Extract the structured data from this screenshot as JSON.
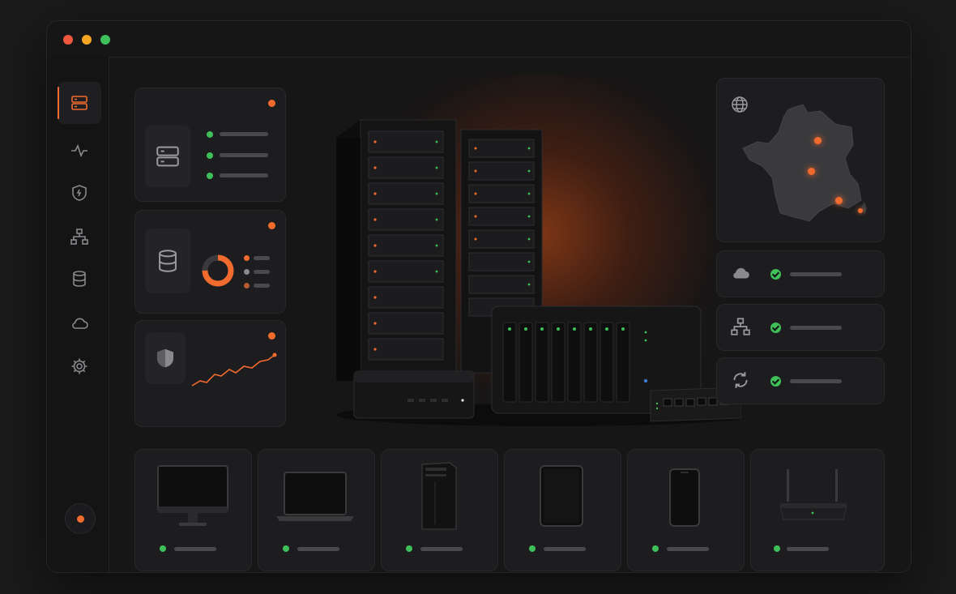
{
  "window": {
    "traffic_lights": [
      {
        "name": "close",
        "color": "#f0573f"
      },
      {
        "name": "minimize",
        "color": "#f5a623"
      },
      {
        "name": "maximize",
        "color": "#3fbf5a"
      }
    ]
  },
  "colors": {
    "accent": "#f26b2e",
    "ok": "#3fbf5a",
    "panel": "#1d1d1f"
  },
  "sidebar": {
    "items": [
      {
        "icon": "server-icon",
        "active": true
      },
      {
        "icon": "activity-icon",
        "active": false
      },
      {
        "icon": "shield-icon",
        "active": false
      },
      {
        "icon": "network-icon",
        "active": false
      },
      {
        "icon": "database-icon",
        "active": false
      },
      {
        "icon": "cloud-icon",
        "active": false
      },
      {
        "icon": "gear-icon",
        "active": false
      }
    ],
    "status_indicator": "alert"
  },
  "widgets": [
    {
      "icon": "server-icon",
      "status_rows": 3,
      "alert": true
    },
    {
      "icon": "database-icon",
      "donut_fraction": 0.75,
      "alert": true
    },
    {
      "icon": "shield-icon",
      "trend": "up",
      "alert": true
    }
  ],
  "map": {
    "icon": "globe-icon",
    "region": "France",
    "markers": 4
  },
  "services": [
    {
      "icon": "cloud-icon",
      "status": "ok"
    },
    {
      "icon": "network-icon",
      "status": "ok"
    },
    {
      "icon": "sync-icon",
      "status": "ok"
    }
  ],
  "devices": [
    {
      "icon": "monitor-icon",
      "status": "online"
    },
    {
      "icon": "laptop-icon",
      "status": "online"
    },
    {
      "icon": "tower-pc-icon",
      "status": "online"
    },
    {
      "icon": "tablet-icon",
      "status": "online"
    },
    {
      "icon": "phone-icon",
      "status": "online"
    },
    {
      "icon": "router-icon",
      "status": "online"
    }
  ]
}
